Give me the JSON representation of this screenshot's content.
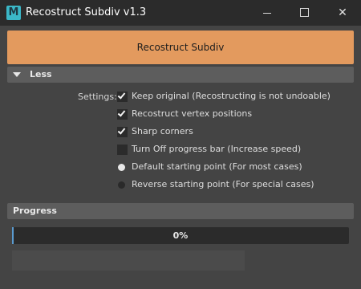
{
  "window": {
    "title": "Recostruct Subdiv v1.3",
    "app_icon_letter": "M",
    "controls": [
      "minimize-icon",
      "maximize-icon",
      "close-icon"
    ],
    "close_glyph": "✕"
  },
  "main_button": {
    "label": "Recostruct Subdiv",
    "color": "#e39a5e"
  },
  "less_section": {
    "label": "Less",
    "expanded": true,
    "settings_label": "Settings:",
    "options": [
      {
        "type": "checkbox",
        "label": "Keep original (Recostructing is not undoable)",
        "checked": true
      },
      {
        "type": "checkbox",
        "label": "Recostruct vertex positions",
        "checked": true
      },
      {
        "type": "checkbox",
        "label": "Sharp corners",
        "checked": true
      },
      {
        "type": "checkbox",
        "label": "Turn Off progress bar (Increase speed)",
        "checked": false
      },
      {
        "type": "radio",
        "label": "Default starting point (For most cases)",
        "selected": true
      },
      {
        "type": "radio",
        "label": "Reverse starting point (For special cases)",
        "selected": false
      }
    ]
  },
  "progress_section": {
    "label": "Progress",
    "percent": 0,
    "text": "0%",
    "accent": "#5a9bd0"
  }
}
